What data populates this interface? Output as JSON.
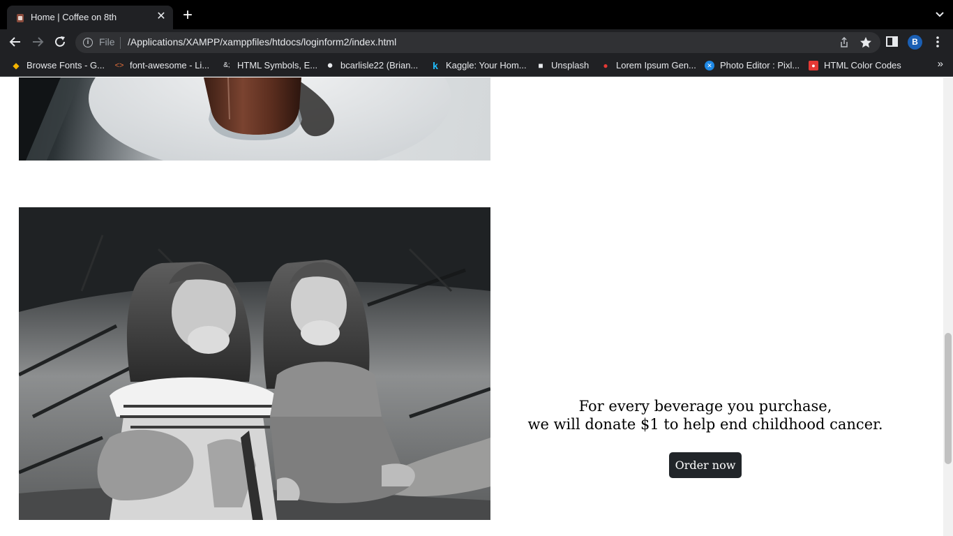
{
  "browser": {
    "tab": {
      "title": "Home | Coffee on 8th",
      "close_glyph": "✕"
    },
    "new_tab_glyph": "+",
    "omnibox": {
      "scheme_label": "File",
      "url": "/Applications/XAMPP/xamppfiles/htdocs/loginform2/index.html"
    },
    "profile_initial": "B",
    "bookmarks": [
      {
        "label": "Browse Fonts - G...",
        "icon": "google-fonts-icon",
        "glyph": "◆",
        "color": "#f4b400"
      },
      {
        "label": "font-awesome - Li...",
        "icon": "code-icon",
        "glyph": "<>",
        "color": "#e8713c"
      },
      {
        "label": "HTML Symbols, E...",
        "icon": "ampersand-icon",
        "glyph": "&;",
        "color": "#e8eaed"
      },
      {
        "label": "bcarlisle22 (Brian...",
        "icon": "github-icon",
        "glyph": "●",
        "color": "#e8eaed"
      },
      {
        "label": "Kaggle: Your Hom...",
        "icon": "kaggle-icon",
        "glyph": "k",
        "color": "#20beff"
      },
      {
        "label": "Unsplash",
        "icon": "unsplash-icon",
        "glyph": "■",
        "color": "#e8eaed"
      },
      {
        "label": "Lorem Ipsum Gen...",
        "icon": "lorem-ipsum-icon",
        "glyph": "●",
        "color": "#e53935"
      },
      {
        "label": "Photo Editor : Pixl...",
        "icon": "pixlr-icon",
        "glyph": "✕",
        "color": "#1e88e5"
      },
      {
        "label": "HTML Color Codes",
        "icon": "html-color-codes-icon",
        "glyph": "●",
        "color": "#e53935"
      }
    ],
    "bookmarks_overflow": "»"
  },
  "page": {
    "promo": {
      "line1": "For every beverage you purchase,",
      "line2": "we will donate $1 to help end childhood cancer."
    },
    "order_button": "Order now"
  },
  "colors": {
    "tabstrip": "#000000",
    "toolbar": "#202124",
    "button": "#212529",
    "page": "#ffffff"
  }
}
